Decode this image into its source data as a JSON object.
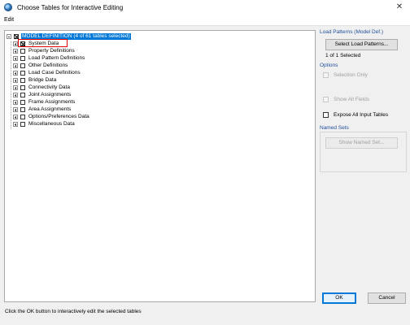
{
  "window": {
    "title": "Choose Tables for Interactive Editing"
  },
  "menu": {
    "edit": "Edit"
  },
  "tree": {
    "root": {
      "label": "MODEL DEFINITION  (4 of 61 tables selected)"
    },
    "items": [
      {
        "label": "System Data",
        "checked": true
      },
      {
        "label": "Property Definitions",
        "checked": false
      },
      {
        "label": "Load Pattern Definitions",
        "checked": false
      },
      {
        "label": "Other Definitions",
        "checked": false
      },
      {
        "label": "Load Case Definitions",
        "checked": false
      },
      {
        "label": "Bridge Data",
        "checked": false
      },
      {
        "label": "Connectivity Data",
        "checked": false
      },
      {
        "label": "Joint Assignments",
        "checked": false
      },
      {
        "label": "Frame Assignments",
        "checked": false
      },
      {
        "label": "Area Assignments",
        "checked": false
      },
      {
        "label": "Options/Preferences Data",
        "checked": false
      },
      {
        "label": "Miscellaneous Data",
        "checked": false
      }
    ]
  },
  "load_patterns": {
    "title": "Load Patterns (Model Def.)",
    "button": "Select Load Patterns...",
    "status": "1 of 1 Selected"
  },
  "options": {
    "title": "Options",
    "selection_only": "Selection Only",
    "show_all_fields": "Show All Fields",
    "expose_all_input_tables": "Expose All Input Tables"
  },
  "named_sets": {
    "title": "Named Sets",
    "button": "Show Named Set..."
  },
  "footer": {
    "ok": "OK",
    "cancel": "Cancel",
    "status": "Click the OK button to interactively edit the selected tables"
  }
}
